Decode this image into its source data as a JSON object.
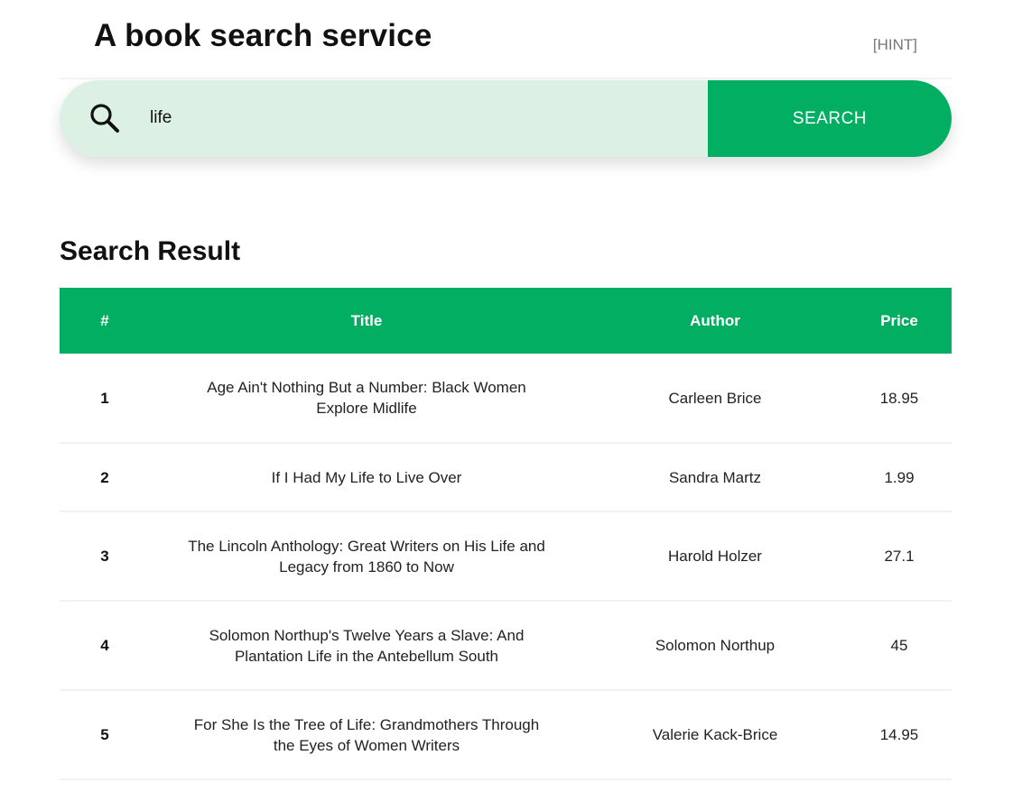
{
  "header": {
    "title": "A book search service",
    "hint_label": "[HINT]"
  },
  "search": {
    "value": "life",
    "button_label": "SEARCH",
    "icon": "search-icon"
  },
  "results": {
    "title": "Search Result",
    "columns": [
      "#",
      "Title",
      "Author",
      "Price"
    ],
    "rows": [
      {
        "num": "1",
        "title": "Age Ain't Nothing But a Number: Black Women Explore Midlife",
        "author": "Carleen Brice",
        "price": "18.95"
      },
      {
        "num": "2",
        "title": "If I Had My Life to Live Over",
        "author": "Sandra Martz",
        "price": "1.99"
      },
      {
        "num": "3",
        "title": "The Lincoln Anthology: Great Writers on His Life and Legacy from 1860 to Now",
        "author": "Harold Holzer",
        "price": "27.1"
      },
      {
        "num": "4",
        "title": "Solomon Northup's Twelve Years a Slave: And Plantation Life in the Antebellum South",
        "author": "Solomon Northup",
        "price": "45"
      },
      {
        "num": "5",
        "title": "For She Is the Tree of Life: Grandmothers Through the Eyes of Women Writers",
        "author": "Valerie Kack-Brice",
        "price": "14.95"
      }
    ]
  },
  "colors": {
    "accent": "#02ae61",
    "search_field_bg": "#dcf0e3"
  }
}
